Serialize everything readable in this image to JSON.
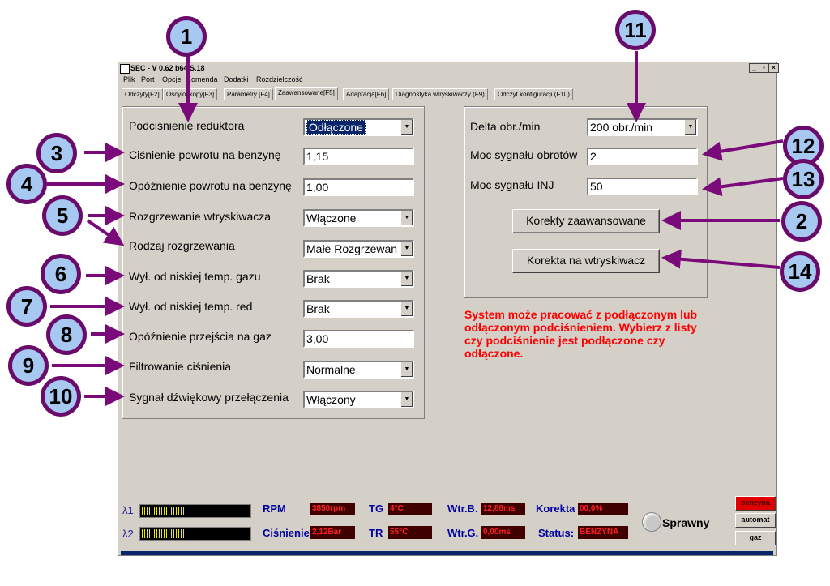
{
  "window": {
    "title": "SEC - V 0.62 b64 S.18",
    "controls": [
      "_",
      "▫",
      "×"
    ]
  },
  "menu": [
    "Plik",
    "Port",
    "Opcje",
    "Komenda",
    "Dodatki",
    "Rozdzielczość"
  ],
  "tabs": [
    "Odczyty[F2]",
    "Oscyloskopy[F3]",
    "Parametry [F4]",
    "Zaawansowane[F5]",
    "Adaptacja[F6]",
    "Diagnostyka wtryskiwaczy (F9)",
    "Odczyt konfiguracji (F10)"
  ],
  "left_panel": {
    "rows": [
      {
        "label": "Podciśnienie reduktora",
        "value": "Odłączone"
      },
      {
        "label": "Ciśnienie powrotu na benzynę",
        "value": "1,15"
      },
      {
        "label": "Opóźnienie powrotu na benzynę",
        "value": "1,00"
      },
      {
        "label": "Rozgrzewanie wtryskiwacza",
        "value": "Włączone"
      },
      {
        "label": "Rodzaj rozgrzewania",
        "value": "Małe Rozgrzewan"
      },
      {
        "label": "Wył. od niskiej temp. gazu",
        "value": "Brak"
      },
      {
        "label": "Wył. od niskiej temp. red",
        "value": "Brak"
      },
      {
        "label": "Opóźnienie przejścia na gaz",
        "value": "3,00"
      },
      {
        "label": "Filtrowanie ciśnienia",
        "value": "Normalne"
      },
      {
        "label": "Sygnał dźwiękowy przełączenia",
        "value": "Włączony"
      }
    ]
  },
  "right_panel": {
    "delta_label": "Delta obr./min",
    "delta_value": "200 obr./min",
    "rpm_signal_label": "Moc sygnału obrotów",
    "rpm_signal_value": "2",
    "inj_signal_label": "Moc sygnału INJ",
    "inj_signal_value": "50",
    "advanced_button": "Korekty zaawansowane",
    "injector_button": "Korekta na wtryskiwacz"
  },
  "info_text": "System może pracować z podłączonym lub odłączonym podciśnieniem. Wybierz z listy czy podciśnienie jest podłączone czy odłączone.",
  "status": {
    "lambda1": "λ1",
    "lambda2": "λ2",
    "lambda1_level": 0.43,
    "lambda2_level": 0.43,
    "rpm_label": "RPM",
    "rpm_value": "3850rpm",
    "pressure_label": "Ciśnienie",
    "pressure_value": "2,12Bar",
    "tg_label": "TG",
    "tg_value": "4°C",
    "tr_label": "TR",
    "tr_value": "55°C",
    "wtrb_label": "Wtr.B.",
    "wtrb_value": "12,88ms",
    "wtrg_label": "Wtr.G.",
    "wtrg_value": "0,00ms",
    "korekta_label": "Korekta",
    "korekta_value": "00,0%",
    "status_label": "Status:",
    "status_value": "BENZYNA",
    "state": "Sprawny",
    "mode_buttons": [
      "benzyna",
      "automat",
      "gaz"
    ]
  },
  "callouts": [
    "1",
    "2",
    "3",
    "4",
    "5",
    "6",
    "7",
    "8",
    "9",
    "10",
    "11",
    "12",
    "13",
    "14"
  ],
  "colors": {
    "callout_fill": "#a7c8f0",
    "callout_border": "#6a0a6a",
    "info_red": "#ff0000"
  }
}
